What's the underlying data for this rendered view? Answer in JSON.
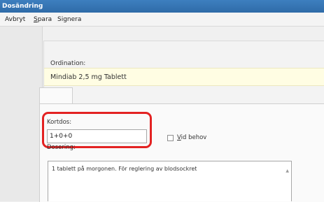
{
  "window": {
    "title": "Dosändring"
  },
  "menu": {
    "avbryt": "Avbryt",
    "spara_first": "S",
    "spara_rest": "para",
    "signera": "Signera"
  },
  "ordination": {
    "label": "Ordination:",
    "value": "Mindiab 2,5 mg Tablett"
  },
  "kortdos": {
    "label": "Kortdos:",
    "value": "1+0+0"
  },
  "vid_behov": {
    "first": "V",
    "rest": "id behov",
    "checked": false
  },
  "dosering": {
    "label": "Dosering:",
    "text": "1 tablett på morgonen. För reglering av blodsockret"
  },
  "colors": {
    "titlebar": "#2f6ba8",
    "highlight": "#e32222",
    "ordination_bg": "#fffde3"
  },
  "icons": {
    "scroll_up": "triangle-up-icon"
  }
}
